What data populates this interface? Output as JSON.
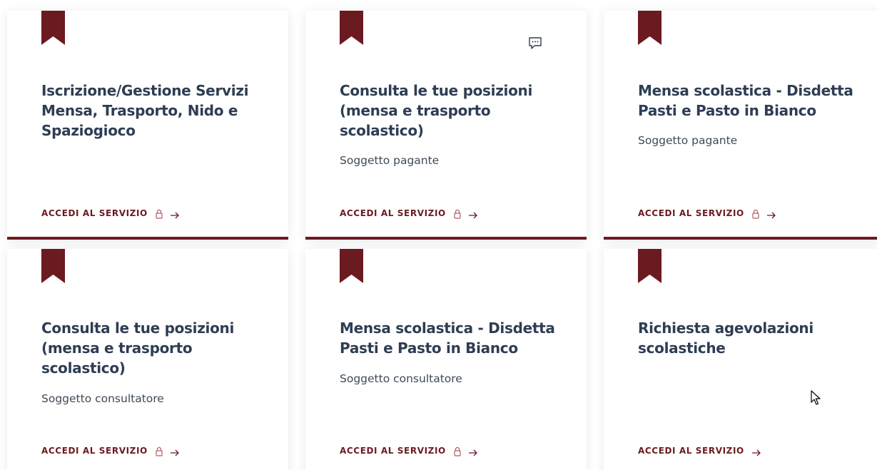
{
  "colors": {
    "accent": "#6b1a20",
    "title": "#2e3d54",
    "text": "#3f4a56"
  },
  "cards": [
    {
      "title_lines": [
        "Iscrizione/Gestione Servizi",
        "Mensa, Trasporto, Nido e",
        "Spaziogioco"
      ],
      "subtitle": "",
      "link_label": "ACCEDI AL SERVIZIO",
      "locked": true
    },
    {
      "title_lines": [
        "Consulta le tue posizioni",
        "(mensa e trasporto",
        "scolastico)"
      ],
      "subtitle": "Soggetto pagante",
      "link_label": "ACCEDI AL SERVIZIO",
      "locked": true,
      "has_chat_icon": true
    },
    {
      "title_lines": [
        "Mensa scolastica - Disdetta",
        "Pasti e Pasto in Bianco"
      ],
      "subtitle": "Soggetto pagante",
      "link_label": "ACCEDI AL SERVIZIO",
      "locked": true
    },
    {
      "title_lines": [
        "Consulta le tue posizioni",
        "(mensa e trasporto",
        "scolastico)"
      ],
      "subtitle": "Soggetto consultatore",
      "link_label": "ACCEDI AL SERVIZIO",
      "locked": true
    },
    {
      "title_lines": [
        "Mensa scolastica - Disdetta",
        "Pasti e Pasto in Bianco"
      ],
      "subtitle": "Soggetto consultatore",
      "link_label": "ACCEDI AL SERVIZIO",
      "locked": true
    },
    {
      "title_lines": [
        "Richiesta agevolazioni",
        "scolastiche"
      ],
      "subtitle": "",
      "link_label": "ACCEDI AL SERVIZIO",
      "locked": false
    }
  ]
}
